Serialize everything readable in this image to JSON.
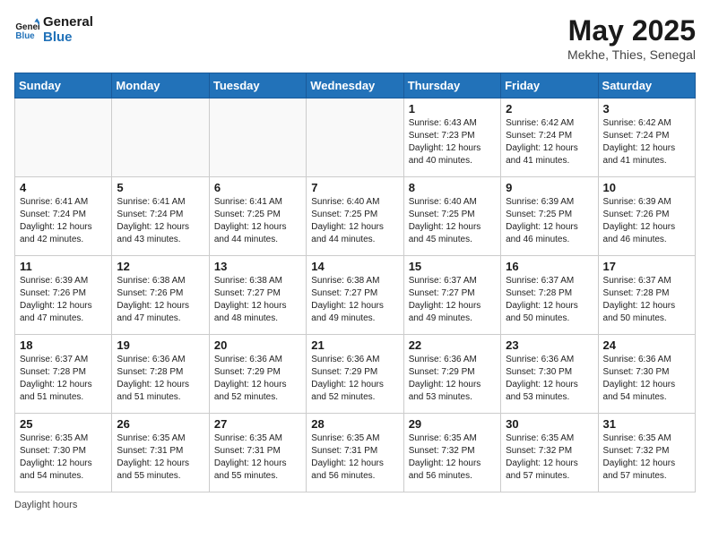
{
  "logo": {
    "line1": "General",
    "line2": "Blue"
  },
  "title": "May 2025",
  "subtitle": "Mekhe, Thies, Senegal",
  "days_of_week": [
    "Sunday",
    "Monday",
    "Tuesday",
    "Wednesday",
    "Thursday",
    "Friday",
    "Saturday"
  ],
  "weeks": [
    [
      {
        "day": "",
        "info": ""
      },
      {
        "day": "",
        "info": ""
      },
      {
        "day": "",
        "info": ""
      },
      {
        "day": "",
        "info": ""
      },
      {
        "day": "1",
        "info": "Sunrise: 6:43 AM\nSunset: 7:23 PM\nDaylight: 12 hours\nand 40 minutes."
      },
      {
        "day": "2",
        "info": "Sunrise: 6:42 AM\nSunset: 7:24 PM\nDaylight: 12 hours\nand 41 minutes."
      },
      {
        "day": "3",
        "info": "Sunrise: 6:42 AM\nSunset: 7:24 PM\nDaylight: 12 hours\nand 41 minutes."
      }
    ],
    [
      {
        "day": "4",
        "info": "Sunrise: 6:41 AM\nSunset: 7:24 PM\nDaylight: 12 hours\nand 42 minutes."
      },
      {
        "day": "5",
        "info": "Sunrise: 6:41 AM\nSunset: 7:24 PM\nDaylight: 12 hours\nand 43 minutes."
      },
      {
        "day": "6",
        "info": "Sunrise: 6:41 AM\nSunset: 7:25 PM\nDaylight: 12 hours\nand 44 minutes."
      },
      {
        "day": "7",
        "info": "Sunrise: 6:40 AM\nSunset: 7:25 PM\nDaylight: 12 hours\nand 44 minutes."
      },
      {
        "day": "8",
        "info": "Sunrise: 6:40 AM\nSunset: 7:25 PM\nDaylight: 12 hours\nand 45 minutes."
      },
      {
        "day": "9",
        "info": "Sunrise: 6:39 AM\nSunset: 7:25 PM\nDaylight: 12 hours\nand 46 minutes."
      },
      {
        "day": "10",
        "info": "Sunrise: 6:39 AM\nSunset: 7:26 PM\nDaylight: 12 hours\nand 46 minutes."
      }
    ],
    [
      {
        "day": "11",
        "info": "Sunrise: 6:39 AM\nSunset: 7:26 PM\nDaylight: 12 hours\nand 47 minutes."
      },
      {
        "day": "12",
        "info": "Sunrise: 6:38 AM\nSunset: 7:26 PM\nDaylight: 12 hours\nand 47 minutes."
      },
      {
        "day": "13",
        "info": "Sunrise: 6:38 AM\nSunset: 7:27 PM\nDaylight: 12 hours\nand 48 minutes."
      },
      {
        "day": "14",
        "info": "Sunrise: 6:38 AM\nSunset: 7:27 PM\nDaylight: 12 hours\nand 49 minutes."
      },
      {
        "day": "15",
        "info": "Sunrise: 6:37 AM\nSunset: 7:27 PM\nDaylight: 12 hours\nand 49 minutes."
      },
      {
        "day": "16",
        "info": "Sunrise: 6:37 AM\nSunset: 7:28 PM\nDaylight: 12 hours\nand 50 minutes."
      },
      {
        "day": "17",
        "info": "Sunrise: 6:37 AM\nSunset: 7:28 PM\nDaylight: 12 hours\nand 50 minutes."
      }
    ],
    [
      {
        "day": "18",
        "info": "Sunrise: 6:37 AM\nSunset: 7:28 PM\nDaylight: 12 hours\nand 51 minutes."
      },
      {
        "day": "19",
        "info": "Sunrise: 6:36 AM\nSunset: 7:28 PM\nDaylight: 12 hours\nand 51 minutes."
      },
      {
        "day": "20",
        "info": "Sunrise: 6:36 AM\nSunset: 7:29 PM\nDaylight: 12 hours\nand 52 minutes."
      },
      {
        "day": "21",
        "info": "Sunrise: 6:36 AM\nSunset: 7:29 PM\nDaylight: 12 hours\nand 52 minutes."
      },
      {
        "day": "22",
        "info": "Sunrise: 6:36 AM\nSunset: 7:29 PM\nDaylight: 12 hours\nand 53 minutes."
      },
      {
        "day": "23",
        "info": "Sunrise: 6:36 AM\nSunset: 7:30 PM\nDaylight: 12 hours\nand 53 minutes."
      },
      {
        "day": "24",
        "info": "Sunrise: 6:36 AM\nSunset: 7:30 PM\nDaylight: 12 hours\nand 54 minutes."
      }
    ],
    [
      {
        "day": "25",
        "info": "Sunrise: 6:35 AM\nSunset: 7:30 PM\nDaylight: 12 hours\nand 54 minutes."
      },
      {
        "day": "26",
        "info": "Sunrise: 6:35 AM\nSunset: 7:31 PM\nDaylight: 12 hours\nand 55 minutes."
      },
      {
        "day": "27",
        "info": "Sunrise: 6:35 AM\nSunset: 7:31 PM\nDaylight: 12 hours\nand 55 minutes."
      },
      {
        "day": "28",
        "info": "Sunrise: 6:35 AM\nSunset: 7:31 PM\nDaylight: 12 hours\nand 56 minutes."
      },
      {
        "day": "29",
        "info": "Sunrise: 6:35 AM\nSunset: 7:32 PM\nDaylight: 12 hours\nand 56 minutes."
      },
      {
        "day": "30",
        "info": "Sunrise: 6:35 AM\nSunset: 7:32 PM\nDaylight: 12 hours\nand 57 minutes."
      },
      {
        "day": "31",
        "info": "Sunrise: 6:35 AM\nSunset: 7:32 PM\nDaylight: 12 hours\nand 57 minutes."
      }
    ]
  ],
  "footer": "Daylight hours"
}
